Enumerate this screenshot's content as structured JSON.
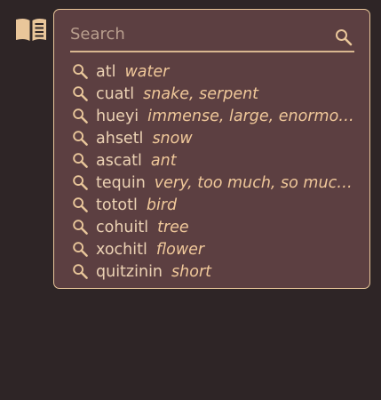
{
  "colors": {
    "background": "#2e2526",
    "panel": "#5c3f41",
    "panel_border": "#e9c69a",
    "accent": "#e9c69a",
    "word_text": "#ecd2b4",
    "gloss_text": "#f0c89a"
  },
  "icons": {
    "app": "book-icon",
    "search": "search-icon"
  },
  "search": {
    "placeholder": "Search",
    "value": ""
  },
  "results": [
    {
      "word": "atl",
      "gloss": "water"
    },
    {
      "word": "cuatl",
      "gloss": "snake, serpent"
    },
    {
      "word": "hueyi",
      "gloss": "immense, large, enormous"
    },
    {
      "word": "ahsetl",
      "gloss": "snow"
    },
    {
      "word": "ascatl",
      "gloss": "ant"
    },
    {
      "word": "tequin",
      "gloss": "very, too much, so much, excessively"
    },
    {
      "word": "tototl",
      "gloss": "bird"
    },
    {
      "word": "cohuitl",
      "gloss": "tree"
    },
    {
      "word": "xochitl",
      "gloss": "flower"
    },
    {
      "word": "quitzinin",
      "gloss": "short"
    }
  ]
}
